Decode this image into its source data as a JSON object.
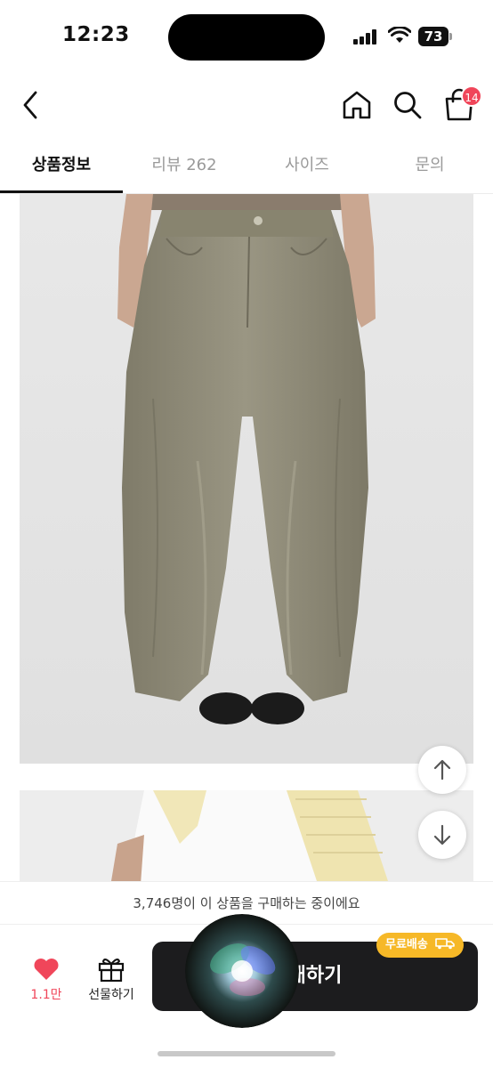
{
  "status_bar": {
    "time": "12:23",
    "battery": "73"
  },
  "header": {
    "icons": [
      "back-arrow-icon",
      "home-icon",
      "search-icon",
      "shopping-bag-icon"
    ],
    "cart_count": "14"
  },
  "tabs": [
    {
      "label": "상품정보",
      "active": true
    },
    {
      "label": "리뷰 262",
      "active": false
    },
    {
      "label": "사이즈",
      "active": false
    },
    {
      "label": "문의",
      "active": false
    }
  ],
  "product": {
    "pants_color": "#8f8b79",
    "background_color": "#e5e5e5"
  },
  "purchase_banner": "3,746명이 이 상품을 구매하는 중이에요",
  "bottom_bar": {
    "like_count": "1.1만",
    "gift_label": "선물하기",
    "buy_label": "매하기",
    "free_shipping_label": "무료배송"
  },
  "colors": {
    "accent_red": "#f0465a",
    "buy_button": "#1c1c1e",
    "shipping_badge": "#f6b827"
  }
}
